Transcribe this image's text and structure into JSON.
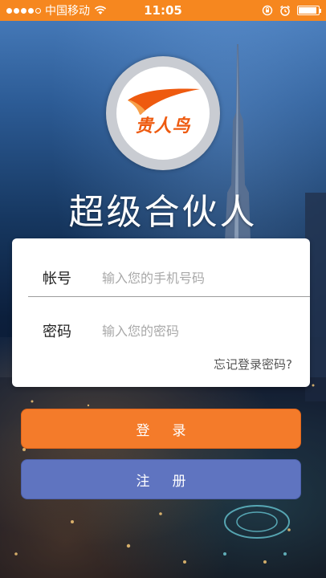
{
  "status_bar": {
    "carrier": "中国移动",
    "time": "11:05",
    "battery_level": 0.85,
    "signal_bars_filled": 4,
    "icons": [
      "signal-icon",
      "wifi-icon",
      "rotation-lock-icon",
      "alarm-icon",
      "battery-icon"
    ]
  },
  "logo": {
    "text": "贵人鸟",
    "color": "#ee5a0f"
  },
  "app_title": "超级合伙人",
  "login_form": {
    "account_label": "帐号",
    "account_placeholder": "输入您的手机号码",
    "password_label": "密码",
    "password_placeholder": "输入您的密码",
    "forgot_password": "忘记登录密码?"
  },
  "buttons": {
    "login": "登录",
    "register": "注册"
  },
  "colors": {
    "accent_orange": "#f47b2a",
    "status_bar": "#f6871f",
    "register_blue": "#5f74c0"
  }
}
